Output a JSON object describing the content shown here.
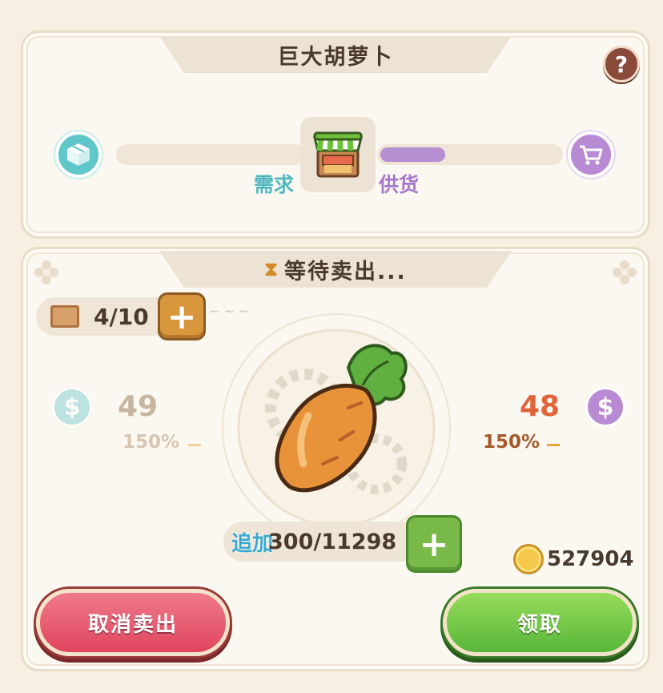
{
  "header": {
    "title": "巨大胡萝卜",
    "help_label": "?"
  },
  "market": {
    "demand_label": "需求",
    "supply_label": "供货",
    "supply_level_fraction": 0.35,
    "demand_icon": "box-icon",
    "supply_icon": "cart-icon",
    "shop_icon": "market-stall-icon"
  },
  "sale": {
    "status": "等待卖出...",
    "status_icon": "hourglass-icon",
    "slots": "4/10",
    "item_icon": "giant-carrot-icon",
    "left_price": "49",
    "left_percent": "150%",
    "right_price": "48",
    "right_percent": "150%",
    "add_label": "追加",
    "amount": "300/11298",
    "coins": "527904"
  },
  "buttons": {
    "cancel": "取消卖出",
    "claim": "领取"
  },
  "colors": {
    "demand": "#4fb8bf",
    "supply": "#a678cc",
    "price_up": "#e0653a",
    "cancel_button": "#e0455e",
    "claim_button": "#58b63a"
  }
}
